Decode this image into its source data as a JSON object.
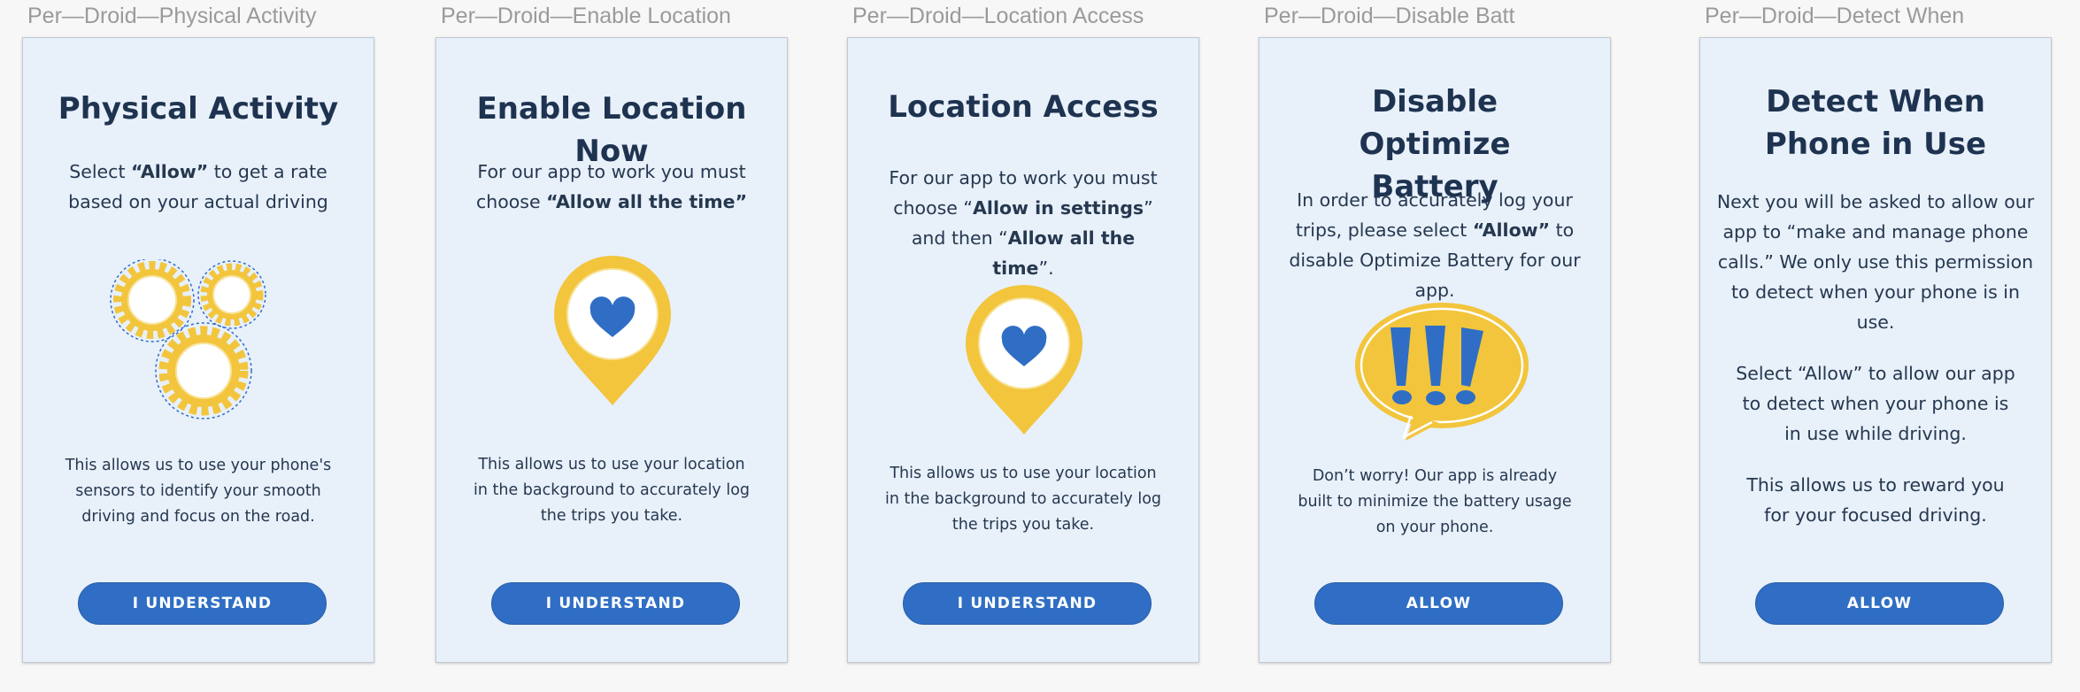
{
  "frames": [
    {
      "label": "Per—Droid—Physical Activity",
      "title": "Physical Activity",
      "body": [
        {
          "pre": "Select ",
          "bold": "“Allow”",
          "post": " to get a rate based on your actual driving"
        }
      ],
      "note": "This allows us to use your phone's sensors to identify your smooth driving and focus on the road.",
      "button": "I UNDERSTAND",
      "illustration": "gears-icon"
    },
    {
      "label": "Per—Droid—Enable Location",
      "title": "Enable Location Now",
      "body": [
        {
          "pre": "For our app to work you must choose ",
          "bold": "“Allow all the time”",
          "post": ""
        }
      ],
      "note": "This allows us to use your location in the background to accurately log the trips you take.",
      "button": "I UNDERSTAND",
      "illustration": "location-heart-pin-icon"
    },
    {
      "label": "Per—Droid—Location Access",
      "title": "Location Access",
      "body": [
        {
          "pre": "For our app to work you must choose “",
          "bold": "Allow in settings",
          "mid": "” and then “",
          "bold2": "Allow all the time",
          "post": "”."
        }
      ],
      "note": "This allows us to use your location in the background to accurately log the trips you take.",
      "button": "I UNDERSTAND",
      "illustration": "location-heart-pin-icon"
    },
    {
      "label": "Per—Droid—Disable Batt",
      "title": "Disable Optimize Battery",
      "body": [
        {
          "pre": "In order to accurately log your trips, please select ",
          "bold": "“Allow”",
          "post": " to disable Optimize Battery for our app."
        }
      ],
      "note": "Don’t worry! Our app is already built to minimize the battery usage on your phone.",
      "button": "ALLOW",
      "illustration": "exclamation-speech-bubble-icon"
    },
    {
      "label": "Per—Droid—Detect When",
      "title": "Detect When Phone in Use",
      "paragraphs": [
        "Next you will be asked to allow our app to “make and manage phone calls.” We only use this permission to detect when your phone is in use.",
        "Select “Allow” to allow our app to detect when your phone is in use while driving.",
        "This allows us to reward you for your focused driving."
      ],
      "button": "ALLOW"
    }
  ],
  "colors": {
    "card_bg": "#e8f0fa",
    "accent_yellow": "#f2c53d",
    "brand_blue": "#2f6ec4",
    "title_text": "#1e3350"
  }
}
